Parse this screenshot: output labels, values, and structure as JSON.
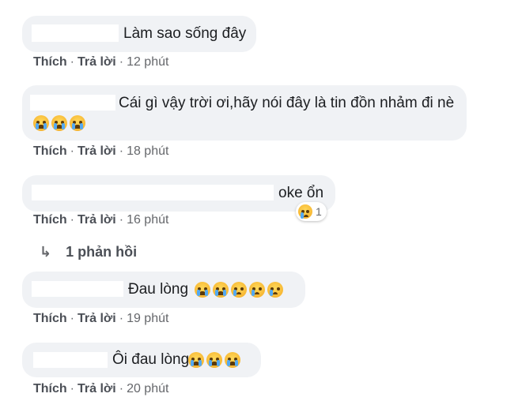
{
  "comments": [
    {
      "text": "Làm sao sống đây",
      "emojis": [],
      "actions": {
        "like": "Thích",
        "reply": "Trả lời",
        "time": "12 phút"
      }
    },
    {
      "text": "Cái gì vậy trời ơi,hãy nói đây là tin đồn nhảm đi nè",
      "emojis": [
        "crying-face-icon",
        "crying-face-icon",
        "crying-face-icon"
      ],
      "actions": {
        "like": "Thích",
        "reply": "Trả lời",
        "time": "18 phút"
      }
    },
    {
      "text": "oke ổn",
      "emojis": [],
      "reaction": {
        "icon": "sad-face-icon",
        "count": "1"
      },
      "actions": {
        "like": "Thích",
        "reply": "Trả lời",
        "time": "16 phút"
      },
      "replies_link": "1 phản hồi"
    },
    {
      "text": "Đau lòng",
      "emojis": [
        "crying-face-icon",
        "crying-face-icon",
        "sad-face-icon",
        "sad-face-icon",
        "sad-face-icon"
      ],
      "actions": {
        "like": "Thích",
        "reply": "Trả lời",
        "time": "19 phút"
      }
    },
    {
      "text": "Ôi đau lòng",
      "emojis": [
        "crying-face-icon",
        "crying-face-icon",
        "crying-face-icon"
      ],
      "actions": {
        "like": "Thích",
        "reply": "Trả lời",
        "time": "20 phút"
      }
    }
  ],
  "colors": {
    "bubble": "#f0f2f5",
    "action_text": "#65676b",
    "tear": "#53a9f2"
  }
}
